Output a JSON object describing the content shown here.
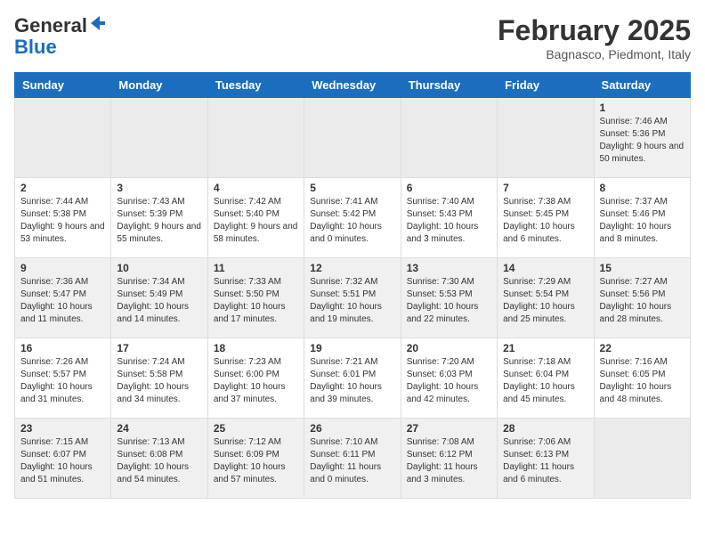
{
  "header": {
    "logo_general": "General",
    "logo_blue": "Blue",
    "title": "February 2025",
    "subtitle": "Bagnasco, Piedmont, Italy"
  },
  "calendar": {
    "days_of_week": [
      "Sunday",
      "Monday",
      "Tuesday",
      "Wednesday",
      "Thursday",
      "Friday",
      "Saturday"
    ],
    "weeks": [
      [
        {
          "day": "",
          "info": ""
        },
        {
          "day": "",
          "info": ""
        },
        {
          "day": "",
          "info": ""
        },
        {
          "day": "",
          "info": ""
        },
        {
          "day": "",
          "info": ""
        },
        {
          "day": "",
          "info": ""
        },
        {
          "day": "1",
          "info": "Sunrise: 7:46 AM\nSunset: 5:36 PM\nDaylight: 9 hours and 50 minutes."
        }
      ],
      [
        {
          "day": "2",
          "info": "Sunrise: 7:44 AM\nSunset: 5:38 PM\nDaylight: 9 hours and 53 minutes."
        },
        {
          "day": "3",
          "info": "Sunrise: 7:43 AM\nSunset: 5:39 PM\nDaylight: 9 hours and 55 minutes."
        },
        {
          "day": "4",
          "info": "Sunrise: 7:42 AM\nSunset: 5:40 PM\nDaylight: 9 hours and 58 minutes."
        },
        {
          "day": "5",
          "info": "Sunrise: 7:41 AM\nSunset: 5:42 PM\nDaylight: 10 hours and 0 minutes."
        },
        {
          "day": "6",
          "info": "Sunrise: 7:40 AM\nSunset: 5:43 PM\nDaylight: 10 hours and 3 minutes."
        },
        {
          "day": "7",
          "info": "Sunrise: 7:38 AM\nSunset: 5:45 PM\nDaylight: 10 hours and 6 minutes."
        },
        {
          "day": "8",
          "info": "Sunrise: 7:37 AM\nSunset: 5:46 PM\nDaylight: 10 hours and 8 minutes."
        }
      ],
      [
        {
          "day": "9",
          "info": "Sunrise: 7:36 AM\nSunset: 5:47 PM\nDaylight: 10 hours and 11 minutes."
        },
        {
          "day": "10",
          "info": "Sunrise: 7:34 AM\nSunset: 5:49 PM\nDaylight: 10 hours and 14 minutes."
        },
        {
          "day": "11",
          "info": "Sunrise: 7:33 AM\nSunset: 5:50 PM\nDaylight: 10 hours and 17 minutes."
        },
        {
          "day": "12",
          "info": "Sunrise: 7:32 AM\nSunset: 5:51 PM\nDaylight: 10 hours and 19 minutes."
        },
        {
          "day": "13",
          "info": "Sunrise: 7:30 AM\nSunset: 5:53 PM\nDaylight: 10 hours and 22 minutes."
        },
        {
          "day": "14",
          "info": "Sunrise: 7:29 AM\nSunset: 5:54 PM\nDaylight: 10 hours and 25 minutes."
        },
        {
          "day": "15",
          "info": "Sunrise: 7:27 AM\nSunset: 5:56 PM\nDaylight: 10 hours and 28 minutes."
        }
      ],
      [
        {
          "day": "16",
          "info": "Sunrise: 7:26 AM\nSunset: 5:57 PM\nDaylight: 10 hours and 31 minutes."
        },
        {
          "day": "17",
          "info": "Sunrise: 7:24 AM\nSunset: 5:58 PM\nDaylight: 10 hours and 34 minutes."
        },
        {
          "day": "18",
          "info": "Sunrise: 7:23 AM\nSunset: 6:00 PM\nDaylight: 10 hours and 37 minutes."
        },
        {
          "day": "19",
          "info": "Sunrise: 7:21 AM\nSunset: 6:01 PM\nDaylight: 10 hours and 39 minutes."
        },
        {
          "day": "20",
          "info": "Sunrise: 7:20 AM\nSunset: 6:03 PM\nDaylight: 10 hours and 42 minutes."
        },
        {
          "day": "21",
          "info": "Sunrise: 7:18 AM\nSunset: 6:04 PM\nDaylight: 10 hours and 45 minutes."
        },
        {
          "day": "22",
          "info": "Sunrise: 7:16 AM\nSunset: 6:05 PM\nDaylight: 10 hours and 48 minutes."
        }
      ],
      [
        {
          "day": "23",
          "info": "Sunrise: 7:15 AM\nSunset: 6:07 PM\nDaylight: 10 hours and 51 minutes."
        },
        {
          "day": "24",
          "info": "Sunrise: 7:13 AM\nSunset: 6:08 PM\nDaylight: 10 hours and 54 minutes."
        },
        {
          "day": "25",
          "info": "Sunrise: 7:12 AM\nSunset: 6:09 PM\nDaylight: 10 hours and 57 minutes."
        },
        {
          "day": "26",
          "info": "Sunrise: 7:10 AM\nSunset: 6:11 PM\nDaylight: 11 hours and 0 minutes."
        },
        {
          "day": "27",
          "info": "Sunrise: 7:08 AM\nSunset: 6:12 PM\nDaylight: 11 hours and 3 minutes."
        },
        {
          "day": "28",
          "info": "Sunrise: 7:06 AM\nSunset: 6:13 PM\nDaylight: 11 hours and 6 minutes."
        },
        {
          "day": "",
          "info": ""
        }
      ]
    ]
  }
}
